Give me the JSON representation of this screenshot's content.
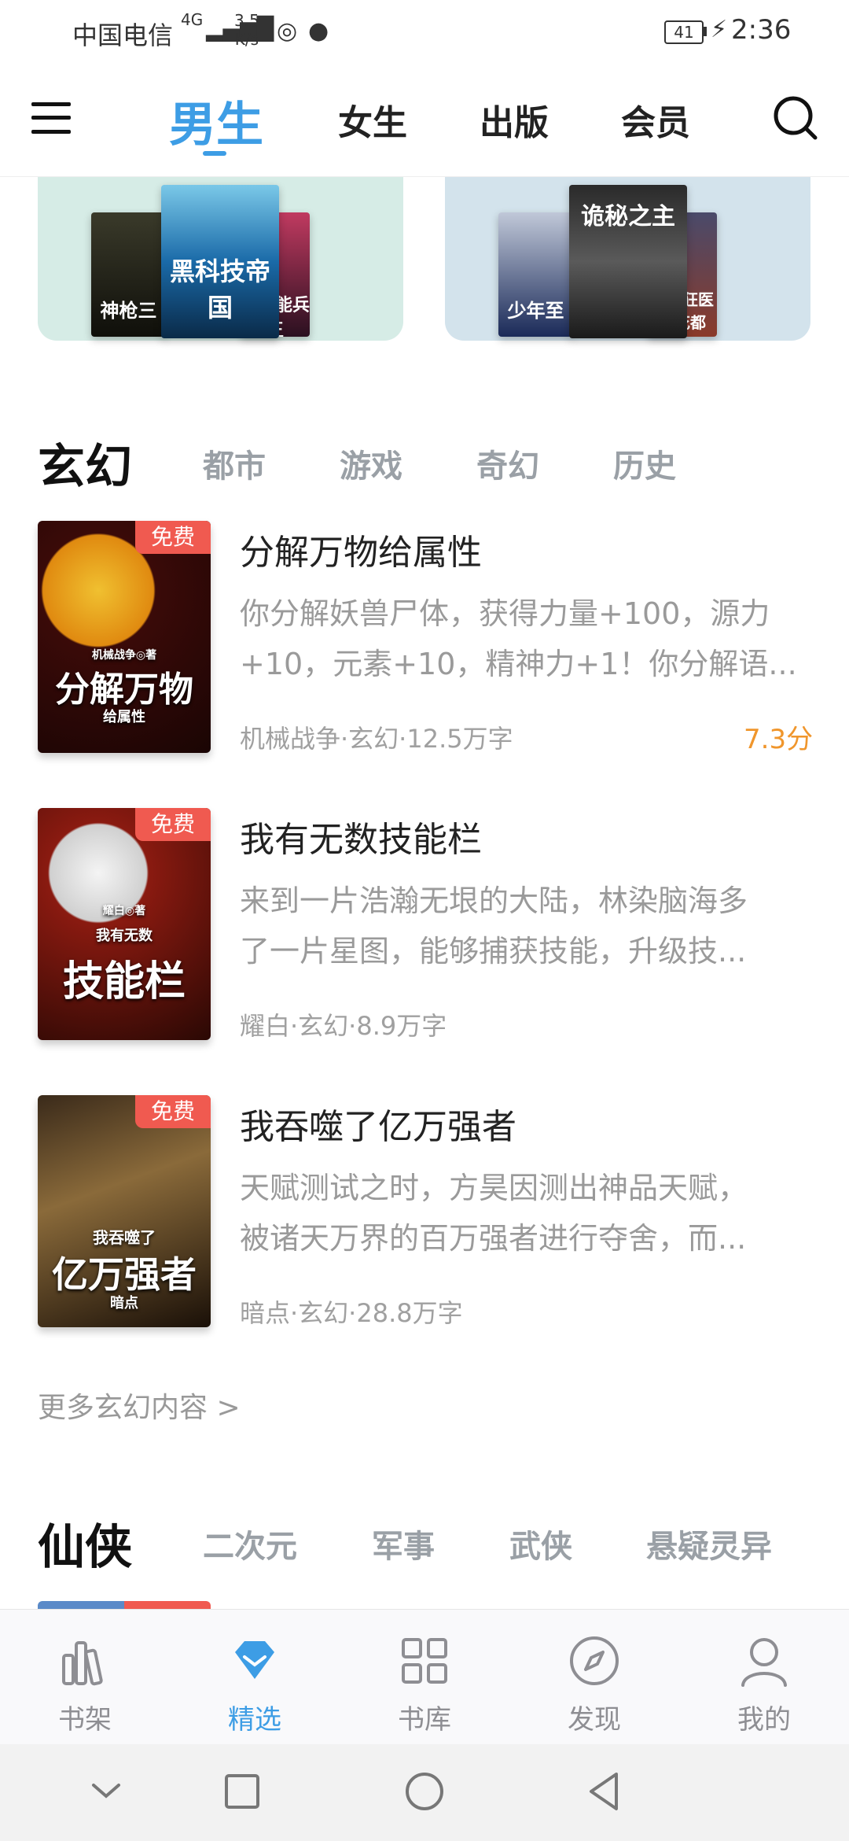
{
  "status_bar": {
    "carrier": "中国电信",
    "network_label": "4G",
    "speed_value": "3.5",
    "speed_unit": "K/s",
    "battery": "41",
    "time": "2:36"
  },
  "top_nav": {
    "tabs": [
      {
        "label": "男生",
        "active": true
      },
      {
        "label": "女生",
        "active": false
      },
      {
        "label": "出版",
        "active": false
      },
      {
        "label": "会员",
        "active": false
      }
    ],
    "accent_color": "#3d9de5"
  },
  "banner": {
    "left_covers": [
      "神枪三",
      "黑科技帝国",
      "超神能兵王"
    ],
    "right_covers": [
      "少年至",
      "诡秘之主",
      "超级狂医在花都"
    ]
  },
  "section_fantasy": {
    "primary": "玄幻",
    "secondary": [
      "都市",
      "游戏",
      "奇幻",
      "历史"
    ],
    "books": [
      {
        "title": "分解万物给属性",
        "desc_line1": "你分解妖兽尸体，获得力量+100，源力",
        "desc_line2": "+10，元素+10，精神力+1！你分解语...",
        "meta": "机械战争·玄幻·12.5万字",
        "score": "7.3分",
        "badge": "免费",
        "cover_text": "分解万物",
        "cover_sub": "给属性",
        "cover_author": "机械战争◎著"
      },
      {
        "title": "我有无数技能栏",
        "desc_line1": "来到一片浩瀚无垠的大陆，林染脑海多",
        "desc_line2": "了一片星图，能够捕获技能，升级技...",
        "meta": "耀白·玄幻·8.9万字",
        "badge": "免费",
        "cover_text": "技能栏",
        "cover_sub": "我有无数",
        "cover_author": "耀白◎著"
      },
      {
        "title": "我吞噬了亿万强者",
        "desc_line1": "天赋测试之时，方昊因测出神品天赋，",
        "desc_line2": "被诸天万界的百万强者进行夺舍，而...",
        "meta": "暗点·玄幻·28.8万字",
        "badge": "免费",
        "cover_text": "亿万强者",
        "cover_sub": "我吞噬了",
        "cover_author": "暗点"
      }
    ],
    "more_link": "更多玄幻内容 >"
  },
  "section_xianxia": {
    "primary": "仙侠",
    "secondary": [
      "二次元",
      "军事",
      "武侠",
      "悬疑灵异"
    ]
  },
  "bottom_tabs": [
    {
      "label": "书架",
      "icon": "bookshelf-icon"
    },
    {
      "label": "精选",
      "icon": "diamond-icon",
      "active": true
    },
    {
      "label": "书库",
      "icon": "grid-icon"
    },
    {
      "label": "发现",
      "icon": "compass-icon"
    },
    {
      "label": "我的",
      "icon": "user-icon"
    }
  ]
}
